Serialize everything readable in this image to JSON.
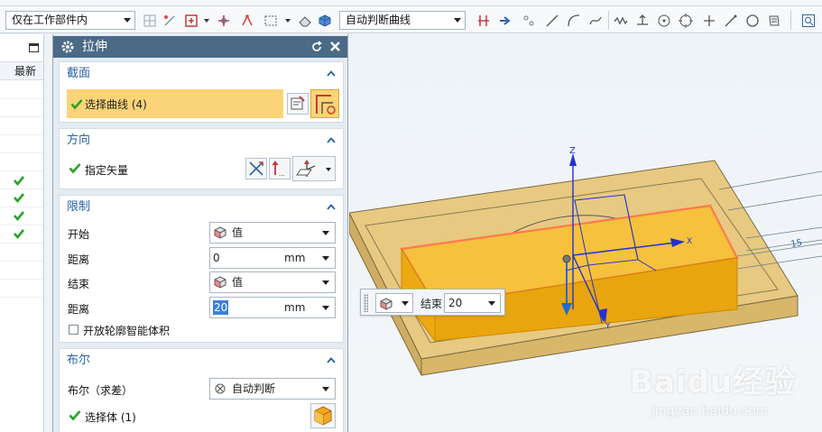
{
  "toolbar": {
    "filter_combo": "仅在工作部件内",
    "curve_rule_combo": "自动判断曲线"
  },
  "left_panel": {
    "column_header": "最新",
    "check_count": 4
  },
  "dialog": {
    "title": "拉伸",
    "section_section": {
      "title": "截面",
      "select_curve_label": "选择曲线 (4)"
    },
    "direction_section": {
      "title": "方向",
      "specify_vector_label": "指定矢量"
    },
    "limits_section": {
      "title": "限制",
      "start_label": "开始",
      "start_option": "值",
      "start_distance_label": "距离",
      "start_distance_value": "0",
      "start_distance_unit": "mm",
      "end_label": "结束",
      "end_option": "值",
      "end_distance_label": "距离",
      "end_distance_value": "20",
      "end_distance_unit": "mm",
      "open_profile_label": "开放轮廓智能体积",
      "open_profile_checked": false
    },
    "boolean_section": {
      "title": "布尔",
      "boolean_label": "布尔（求差）",
      "boolean_option": "自动判断",
      "select_body_label": "选择体 (1)"
    }
  },
  "viewport": {
    "axis_z": "Z",
    "axis_x": "X",
    "axis_y": "Y",
    "dimension_label": "15"
  },
  "float_widget": {
    "label": "结束",
    "value": "20"
  },
  "watermark": {
    "brand": "Baidu经验",
    "url": "jingyan.baidu.com"
  },
  "colors": {
    "title_bar": "#4a6a86",
    "section_title": "#2a63a8",
    "selection_highlight": "#fbd477",
    "check_green": "#29a329",
    "preview_orange": "#f3b215",
    "block_tan": "#e7c981"
  }
}
